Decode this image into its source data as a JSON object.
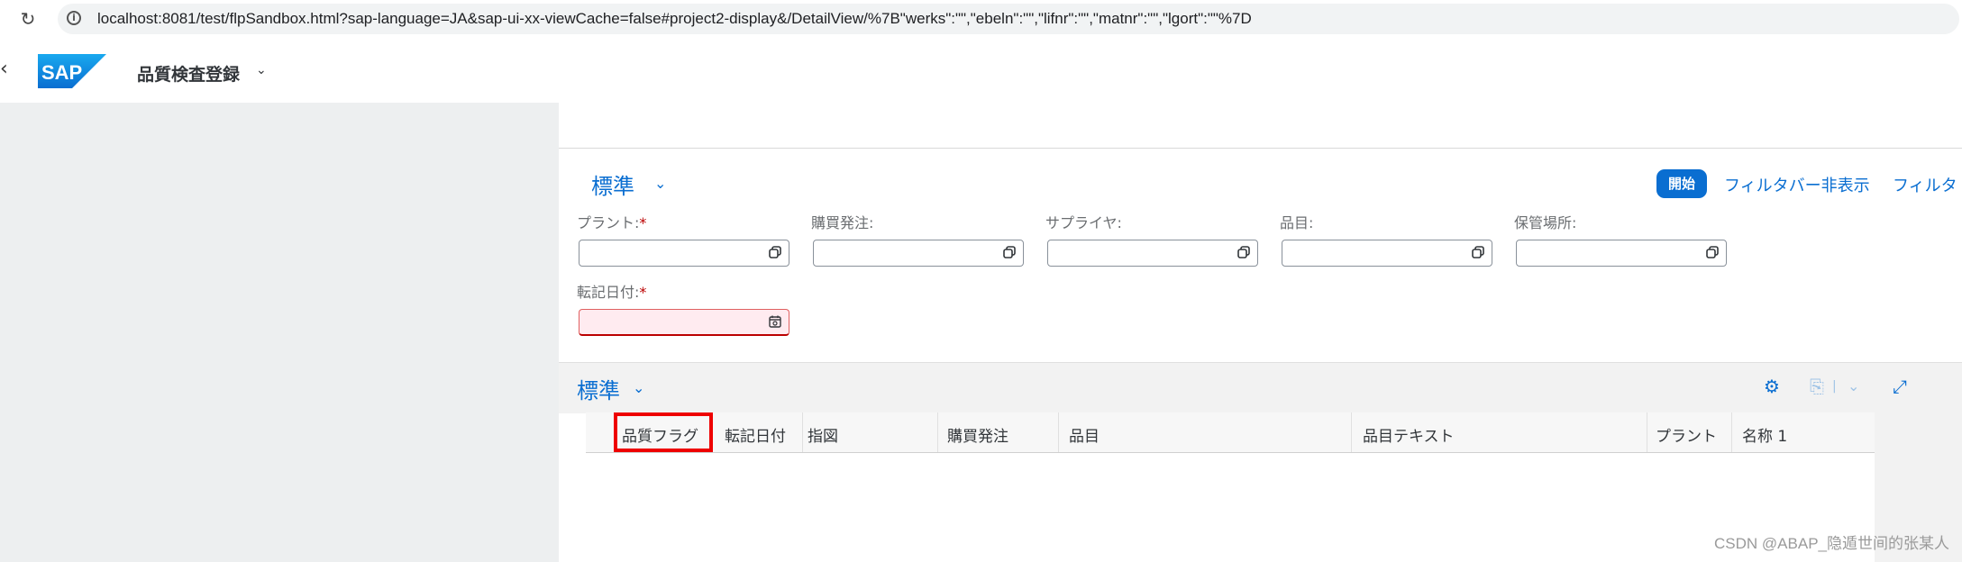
{
  "browser": {
    "url": "localhost:8081/test/flpSandbox.html?sap-language=JA&sap-ui-xx-viewCache=false#project2-display&/DetailView/%7B\"werks\":\"\",\"ebeln\":\"\",\"lifnr\":\"\",\"matnr\":\"\",\"lgort\":\"\"%7D"
  },
  "shell": {
    "app_title": "品質検査登録"
  },
  "filterbar": {
    "variant": "標準",
    "go_label": "開始",
    "hide_label": "フィルタバー非表示",
    "filters_label": "フィルタ",
    "fields": [
      {
        "label": "プラント:",
        "required": "*",
        "value": ""
      },
      {
        "label": "購買発注:",
        "required": "",
        "value": ""
      },
      {
        "label": "サプライヤ:",
        "required": "",
        "value": ""
      },
      {
        "label": "品目:",
        "required": "",
        "value": ""
      },
      {
        "label": "保管場所:",
        "required": "",
        "value": ""
      },
      {
        "label": "転記日付:",
        "required": "*",
        "value": ""
      }
    ]
  },
  "table": {
    "variant": "標準",
    "columns": [
      "品質フラグ",
      "転記日付",
      "指図",
      "購買発注",
      "品目",
      "品目テキスト",
      "プラント",
      "名称 1"
    ]
  },
  "watermark": "CSDN @ABAP_隐遁世间的张某人",
  "colors": {
    "accent": "#0a6ed1",
    "highlight": "#ee0000",
    "error_bg": "#ffebf0"
  }
}
